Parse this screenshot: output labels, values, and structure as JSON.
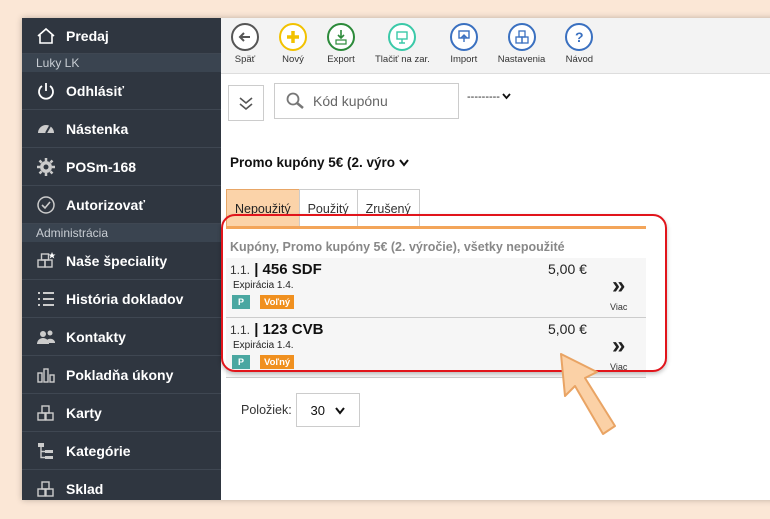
{
  "sidebar": {
    "items": [
      {
        "label": "Predaj",
        "icon": "home-icon"
      },
      {
        "section": "Luky LK"
      },
      {
        "label": "Odhlásiť",
        "icon": "power-icon"
      },
      {
        "label": "Nástenka",
        "icon": "dashboard-icon"
      },
      {
        "label": "POSm-168",
        "icon": "gear-icon"
      },
      {
        "label": "Autorizovať",
        "icon": "check-circle-icon"
      },
      {
        "section": "Administrácia"
      },
      {
        "label": "Naše špeciality",
        "icon": "star-boxes-icon"
      },
      {
        "label": "História dokladov",
        "icon": "list-icon"
      },
      {
        "label": "Kontakty",
        "icon": "users-icon"
      },
      {
        "label": "Pokladňa úkony",
        "icon": "bar-chart-icon"
      },
      {
        "label": "Karty",
        "icon": "boxes-icon"
      },
      {
        "label": "Kategórie",
        "icon": "tree-icon"
      },
      {
        "label": "Sklad",
        "icon": "boxes-icon"
      }
    ]
  },
  "toolbar": {
    "buttons": [
      {
        "label": "Späť",
        "icon": "back-arrow-icon",
        "color": "#555555"
      },
      {
        "label": "Nový",
        "icon": "plus-icon",
        "color": "#f2c200"
      },
      {
        "label": "Export",
        "icon": "export-xml-icon",
        "color": "#2c8a3a"
      },
      {
        "label": "Tlačiť na zar.",
        "icon": "print-device-icon",
        "color": "#3ac9a8"
      },
      {
        "label": "Import",
        "icon": "import-icon",
        "color": "#3a70c0"
      },
      {
        "label": "Nastavenia",
        "icon": "settings-boxes-icon",
        "color": "#3a70c0"
      },
      {
        "label": "Návod",
        "icon": "help-icon",
        "color": "#3a70c0"
      }
    ]
  },
  "search": {
    "placeholder": "Kód kupónu",
    "value": ""
  },
  "filter": {
    "value": "---------"
  },
  "promo_select": {
    "value": "Promo kupóny 5€ (2. výro"
  },
  "tabs": [
    {
      "label": "Nepoužitý",
      "active": true
    },
    {
      "label": "Použitý",
      "active": false
    },
    {
      "label": "Zrušený",
      "active": false
    }
  ],
  "list": {
    "title": "Kupóny, Promo kupóny 5€ (2. výročie), všetky nepoužité",
    "rows": [
      {
        "prefix": "1.1.",
        "code": "| 456 SDF",
        "expiry": "Expirácia 1.4.",
        "price": "5,00 €",
        "badge_p": "P",
        "status": "Voľný",
        "more": "»",
        "more_label": "Viac"
      },
      {
        "prefix": "1.1.",
        "code": "| 123 CVB",
        "expiry": "Expirácia 1.4.",
        "price": "5,00 €",
        "badge_p": "P",
        "status": "Voľný",
        "more": "»",
        "more_label": "Viac"
      }
    ]
  },
  "pagination": {
    "label": "Položiek:",
    "value": "30"
  },
  "colors": {
    "accent": "#f3a55a",
    "highlight": "#e1141b",
    "sidebar": "#2f3640"
  }
}
